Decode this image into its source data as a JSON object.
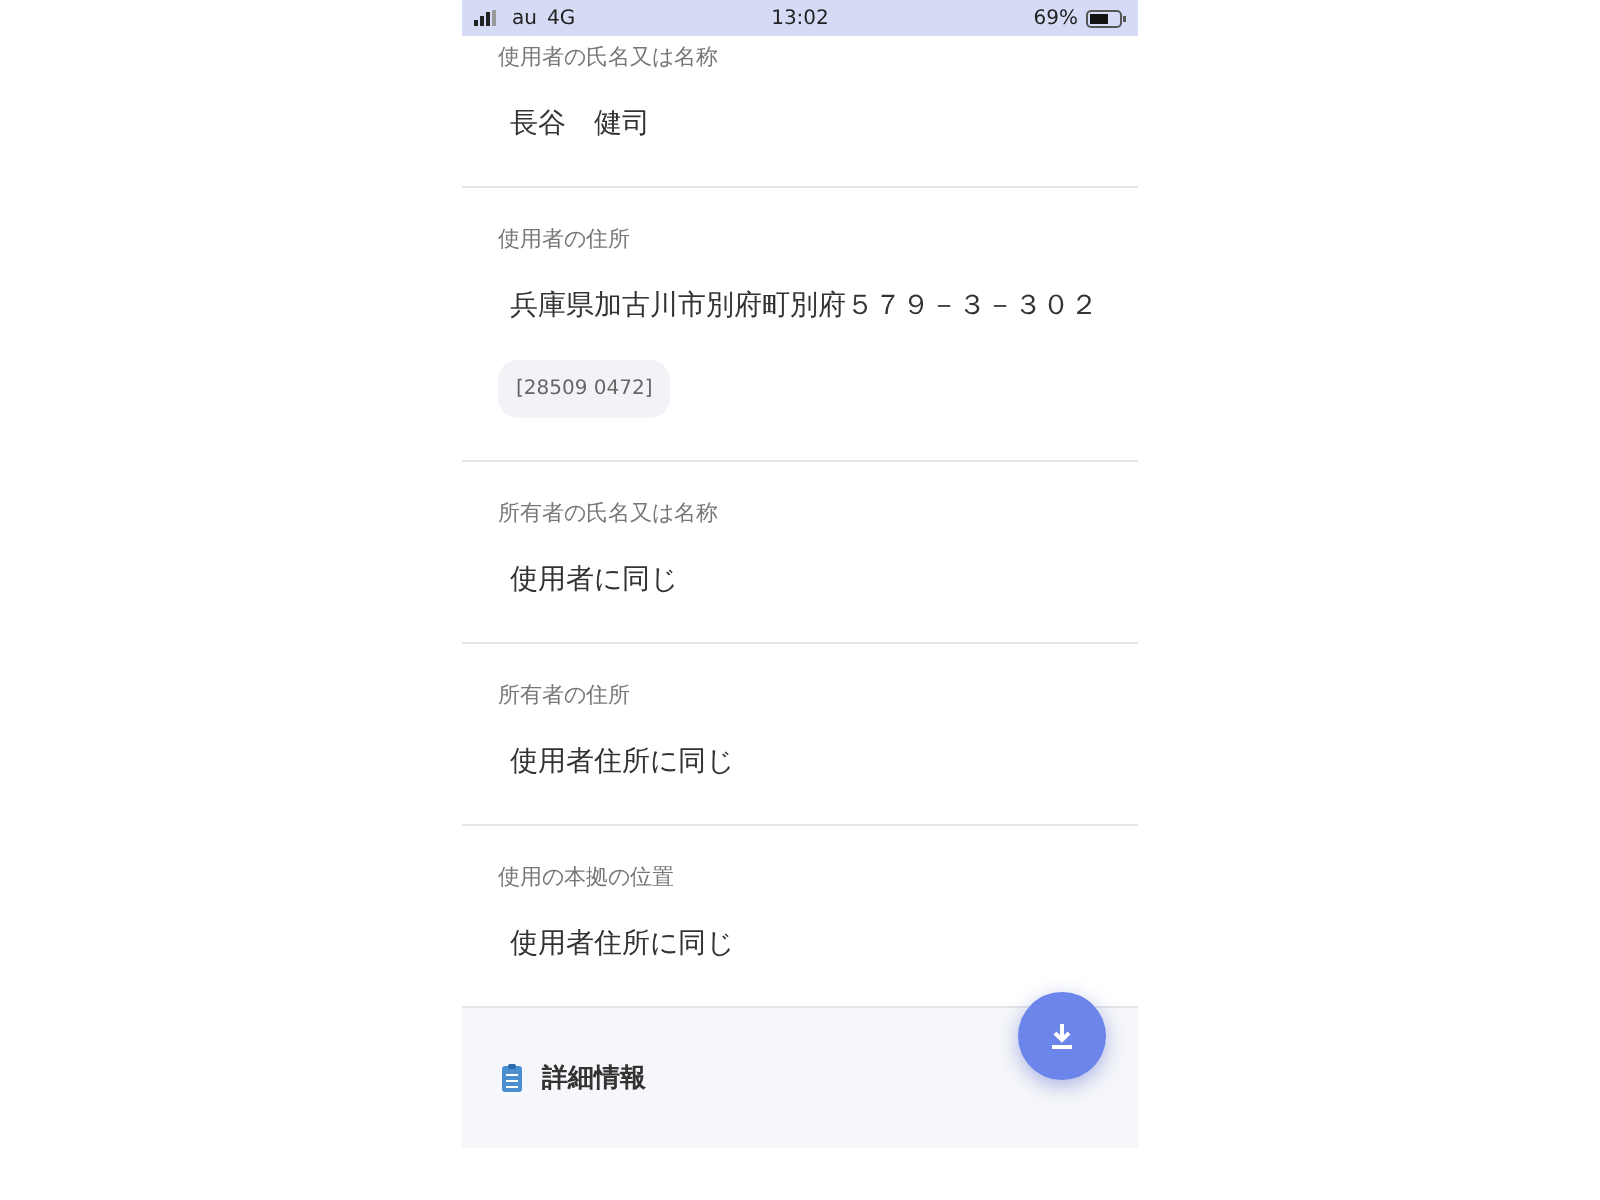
{
  "status_bar": {
    "carrier": "au",
    "network": "4G",
    "time": "13:02",
    "battery": "69%"
  },
  "fields": [
    {
      "label": "使用者の氏名又は名称",
      "value": "長谷　健司"
    },
    {
      "label": "使用者の住所",
      "value": "兵庫県加古川市別府町別府５７９－３－３０２",
      "code": "[28509 0472]"
    },
    {
      "label": "所有者の氏名又は名称",
      "value": "使用者に同じ"
    },
    {
      "label": "所有者の住所",
      "value": "使用者住所に同じ"
    },
    {
      "label": "使用の本拠の位置",
      "value": "使用者住所に同じ"
    }
  ],
  "details": {
    "title": "詳細情報"
  }
}
